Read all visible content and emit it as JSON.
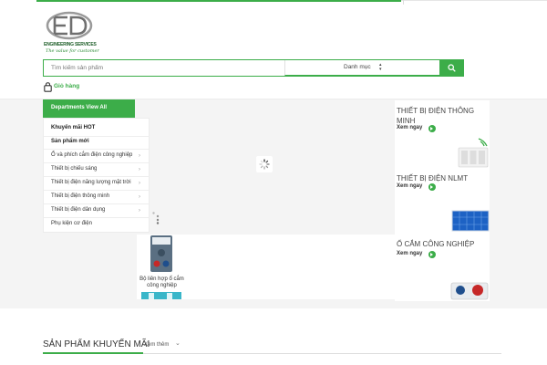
{
  "brand": {
    "logo_text": "ENGINEERING SERVICES",
    "tagline": "The value for customer",
    "accent_color": "#3cad49"
  },
  "search": {
    "placeholder": "Tìm kiếm sản phẩm",
    "category_label": "Danh mục",
    "button_icon": "search-icon"
  },
  "cart": {
    "label": "Giỏ hàng",
    "icon": "shopping-bag-icon"
  },
  "departments": {
    "header": "Departments View All",
    "items": [
      {
        "label": "Khuyến mãi HOT",
        "bold": true
      },
      {
        "label": "Sản phẩm mới",
        "bold": true
      },
      {
        "label": "Ổ và phích cắm điện công nghiệp"
      },
      {
        "label": "Thiết bị chiếu sáng"
      },
      {
        "label": "Thiết bị điện năng lượng mặt trời"
      },
      {
        "label": "Thiết bị điện thông minh"
      },
      {
        "label": "Thiết bị điện dân dụng"
      },
      {
        "label": "Phụ kiện cơ điện"
      }
    ]
  },
  "promo_product": {
    "name": "Bộ liên hợp ổ cắm công nghiệp"
  },
  "banners": [
    {
      "title": "THIẾT BỊ ĐIỆN THÔNG MINH",
      "more": "Xem ngay"
    },
    {
      "title": "THIẾT BỊ ĐIỆN NLMT",
      "more": "Xem ngay"
    },
    {
      "title": "Ổ CẮM CÔNG NGHIỆP",
      "more": "Xem ngay"
    }
  ],
  "section": {
    "title": "SẢN PHẨM KHUYẾN MÃI",
    "more": "Xem thêm"
  }
}
